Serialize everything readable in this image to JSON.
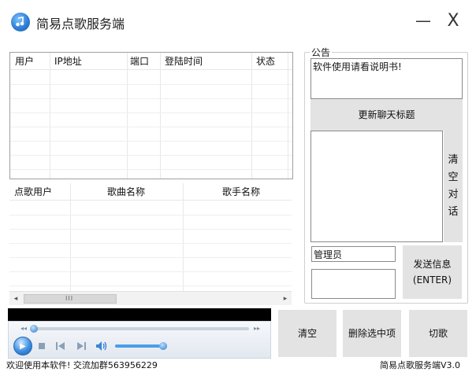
{
  "window": {
    "title": "简易点歌服务端",
    "minimize_glyph": "—",
    "close_glyph": "X"
  },
  "clients_table": {
    "columns": [
      "用户",
      "IP地址",
      "端口",
      "登陆时间",
      "状态"
    ]
  },
  "songs_table": {
    "columns": [
      "点歌用户",
      "歌曲名称",
      "歌手名称"
    ]
  },
  "scrollbar": {
    "left_arrow": "◂",
    "right_arrow": "▸",
    "grip": "III"
  },
  "player": {
    "icons": [
      "play-icon",
      "stop-icon",
      "previous-icon",
      "next-icon",
      "volume-icon"
    ]
  },
  "buttons": {
    "clear": "清空",
    "delete_selected": "删除选中项",
    "skip_song": "切歌",
    "update_title": "更新聊天标题",
    "clear_chat": "清空对话",
    "send": "发送信息",
    "send_hint": "(ENTER)"
  },
  "announcement": {
    "label": "公告",
    "text": "软件使用请看说明书!"
  },
  "admin": {
    "name": "管理员"
  },
  "status": {
    "left": "欢迎使用本软件! 交流加群563956229",
    "right": "简易点歌服务端V3.0"
  },
  "colors": {
    "accent": "#2f7fd6",
    "button_gray": "#e3e3e3"
  }
}
